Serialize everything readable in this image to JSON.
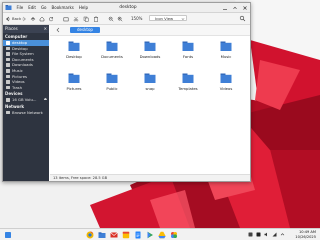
{
  "window": {
    "title": "desktop",
    "menu": [
      "File",
      "Edit",
      "Go",
      "Bookmarks",
      "Help"
    ],
    "zoom": "150%",
    "view_mode": "Icon View"
  },
  "sidebar": {
    "header": "Places",
    "sections": [
      {
        "title": "Computer",
        "items": [
          "desktop",
          "Desktop",
          "File System",
          "Documents",
          "Downloads",
          "Music",
          "Pictures",
          "Videos",
          "Trash"
        ]
      },
      {
        "title": "Devices",
        "items": [
          "16 GB Volu..."
        ]
      },
      {
        "title": "Network",
        "items": [
          "Browse Network"
        ]
      }
    ],
    "active_item": "desktop"
  },
  "location": {
    "current": "desktop"
  },
  "files": [
    {
      "name": "Desktop",
      "icon": "folder-icon"
    },
    {
      "name": "Documents",
      "icon": "folder-documents-icon"
    },
    {
      "name": "Downloads",
      "icon": "folder-downloads-icon"
    },
    {
      "name": "Fonts",
      "icon": "folder-fonts-icon"
    },
    {
      "name": "Music",
      "icon": "folder-music-icon"
    },
    {
      "name": "Pictures",
      "icon": "folder-pictures-icon"
    },
    {
      "name": "Public",
      "icon": "folder-public-icon"
    },
    {
      "name": "snap",
      "icon": "folder-icon"
    },
    {
      "name": "Templates",
      "icon": "folder-templates-icon"
    },
    {
      "name": "Videos",
      "icon": "folder-videos-icon"
    }
  ],
  "statusbar": {
    "text": "13 items, Free space: 28.5 GB"
  },
  "taskbar": {
    "time": "10:49 AM",
    "date": "10/26/2025"
  },
  "colors": {
    "folder": "#3f7fd6",
    "folder_tab": "#2f66b8",
    "accent": "#3584e4",
    "sidebar_bg": "#2e3440",
    "wallpaper_red": "#c8102e"
  }
}
